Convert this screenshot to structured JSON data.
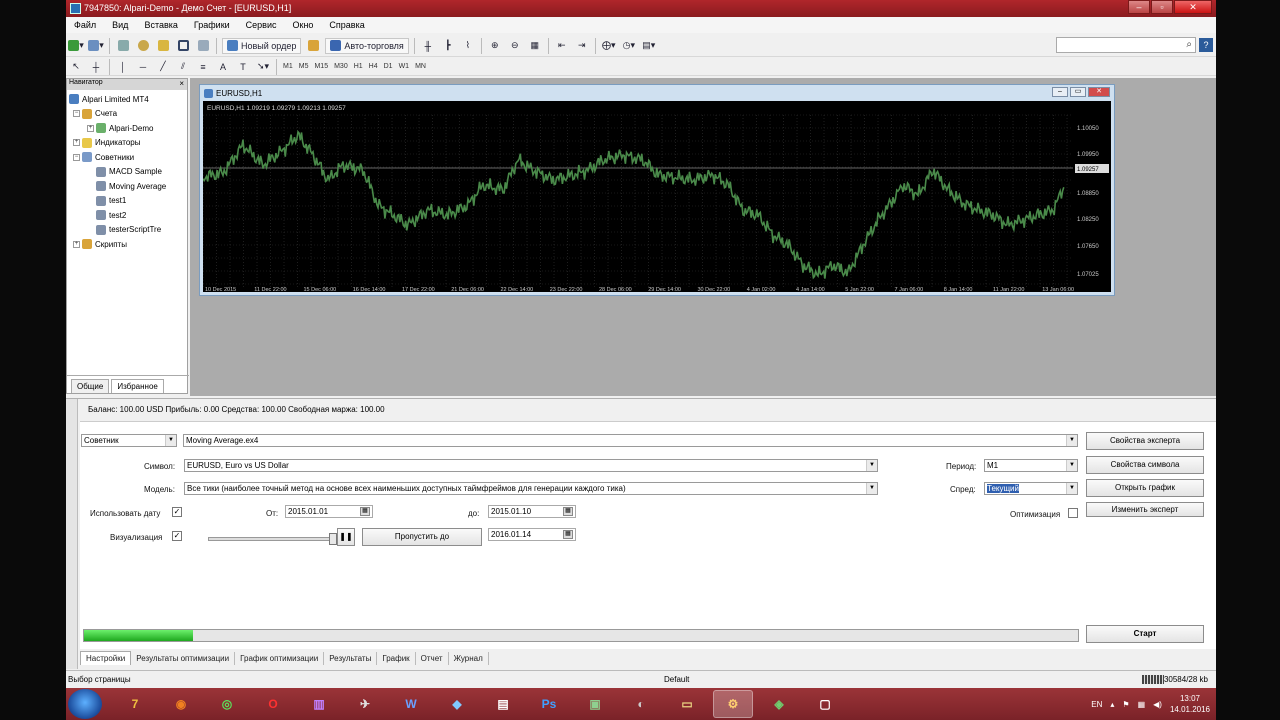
{
  "window": {
    "title": "7947850: Alpari-Demo - Демо Счет - [EURUSD,H1]"
  },
  "menu": [
    "Файл",
    "Вид",
    "Вставка",
    "Графики",
    "Сервис",
    "Окно",
    "Справка"
  ],
  "toolbar": {
    "new_order": "Новый ордер",
    "autotrading": "Авто-торговля"
  },
  "periods": [
    "M1",
    "M5",
    "M15",
    "M30",
    "H1",
    "H4",
    "D1",
    "W1",
    "MN"
  ],
  "navigator": {
    "title": "Навигатор",
    "items": [
      {
        "label": "Alpari Limited MT4",
        "level": 0
      },
      {
        "label": "Счета",
        "level": 1
      },
      {
        "label": "Alpari-Demo",
        "level": 2
      },
      {
        "label": "Индикаторы",
        "level": 1
      },
      {
        "label": "Советники",
        "level": 1
      },
      {
        "label": "MACD Sample",
        "level": 2
      },
      {
        "label": "Moving Average",
        "level": 2
      },
      {
        "label": "test1",
        "level": 2
      },
      {
        "label": "test2",
        "level": 2
      },
      {
        "label": "testerScriptTre",
        "level": 2
      },
      {
        "label": "Скрипты",
        "level": 1
      }
    ],
    "tabs": [
      "Общие",
      "Избранное"
    ]
  },
  "chart": {
    "title": "EURUSD,H1",
    "header": "EURUSD,H1  1.09219 1.09279 1.09213 1.09257",
    "price_labels": [
      "1.10050",
      "1.09950",
      "1.09257",
      "1.08850",
      "1.08250",
      "1.07650",
      "1.07025"
    ],
    "time_labels": [
      "10 Dec 2015",
      "11 Dec 22:00",
      "15 Dec 06:00",
      "16 Dec 14:00",
      "17 Dec 22:00",
      "21 Dec 06:00",
      "22 Dec 14:00",
      "23 Dec 22:00",
      "28 Dec 06:00",
      "29 Dec 14:00",
      "30 Dec 22:00",
      "4 Jan 02:00",
      "4 Jan 14:00",
      "5 Jan 22:00",
      "7 Jan 06:00",
      "8 Jan 14:00",
      "11 Jan 22:00",
      "13 Jan 06:00"
    ],
    "line_color": "#4a8a4a"
  },
  "terminal": {
    "balance": "Баланс: 100.00 USD  Прибыль: 0.00  Средства: 100.00  Свободная маржа: 100.00",
    "type_select": "Советник",
    "expert_file": "Moving Average.ex4",
    "symbol_label": "Символ:",
    "symbol_value": "EURUSD, Euro vs US Dollar",
    "model_label": "Модель:",
    "model_value": "Все тики (наиболее точный метод на основе всех наименьших доступных таймфреймов для генерации каждого тика)",
    "use_date_label": "Использовать дату",
    "from_label": "От:",
    "from_value": "2015.01.01",
    "to_label": "до:",
    "to_value": "2015.01.10",
    "visual_label": "Визуализация",
    "skip_button": "Пропустить до",
    "skip_value": "2016.01.14",
    "period_label": "Период:",
    "period_value": "M1",
    "spread_label": "Спред:",
    "spread_value": "Текущий",
    "optimization_label": "Оптимизация",
    "btn_expert_props": "Свойства эксперта",
    "btn_symbol_props": "Свойства символа",
    "btn_open_chart": "Открыть график",
    "btn_modify_expert": "Изменить эксперт",
    "btn_start": "Старт",
    "progress": 0.11,
    "tabs": [
      "Настройки",
      "Результаты оптимизации",
      "График оптимизации",
      "Результаты",
      "График",
      "Отчет",
      "Журнал"
    ]
  },
  "status": {
    "left": "Выбор страницы",
    "profile": "Default",
    "traffic": "30584/28 kb"
  },
  "taskbar": {
    "lang": "EN",
    "time": "13:07",
    "date": "14.01.2016"
  }
}
